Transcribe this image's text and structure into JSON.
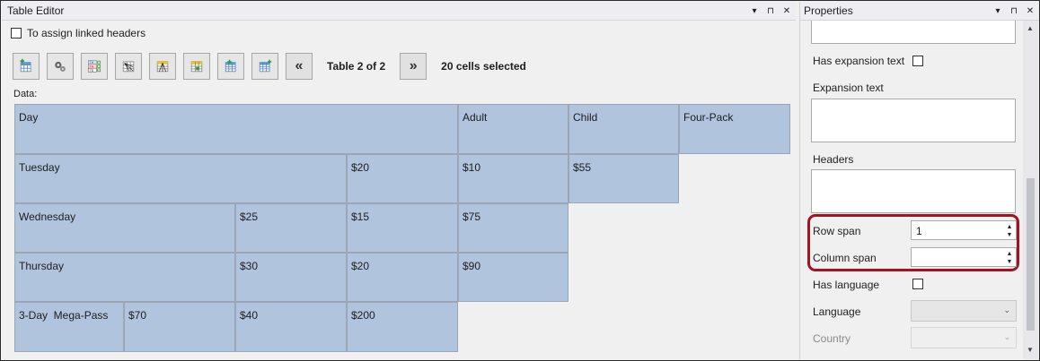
{
  "table_editor": {
    "title": "Table Editor",
    "window_buttons": {
      "menu": "▾",
      "pin": "⊓",
      "close": "✕"
    },
    "assign_linked_headers_label": "To assign linked headers",
    "nav": {
      "prev": "«",
      "next": "»"
    },
    "table_info": "Table 2 of 2",
    "cells_selected": "20 cells selected",
    "data_label": "Data:",
    "rows": [
      [
        "Day",
        "Adult",
        "Child",
        "Four-Pack"
      ],
      [
        "Tuesday",
        "$20",
        "$10",
        "$55"
      ],
      [
        "Wednesday",
        "$25",
        "$15",
        "$75"
      ],
      [
        "Thursday",
        "$30",
        "$20",
        "$90"
      ],
      [
        "3-Day  Mega-Pass",
        "$70",
        "$40",
        "$200"
      ]
    ]
  },
  "properties": {
    "title": "Properties",
    "window_buttons": {
      "menu": "▾",
      "pin": "⊓",
      "close": "✕"
    },
    "has_expansion_text_label": "Has expansion text",
    "expansion_text_label": "Expansion text",
    "headers_label": "Headers",
    "row_span_label": "Row span",
    "row_span_value": "1",
    "column_span_label": "Column span",
    "column_span_value": "",
    "has_language_label": "Has language",
    "language_label": "Language",
    "country_label": "Country",
    "highlight_color": "#a3141e"
  }
}
